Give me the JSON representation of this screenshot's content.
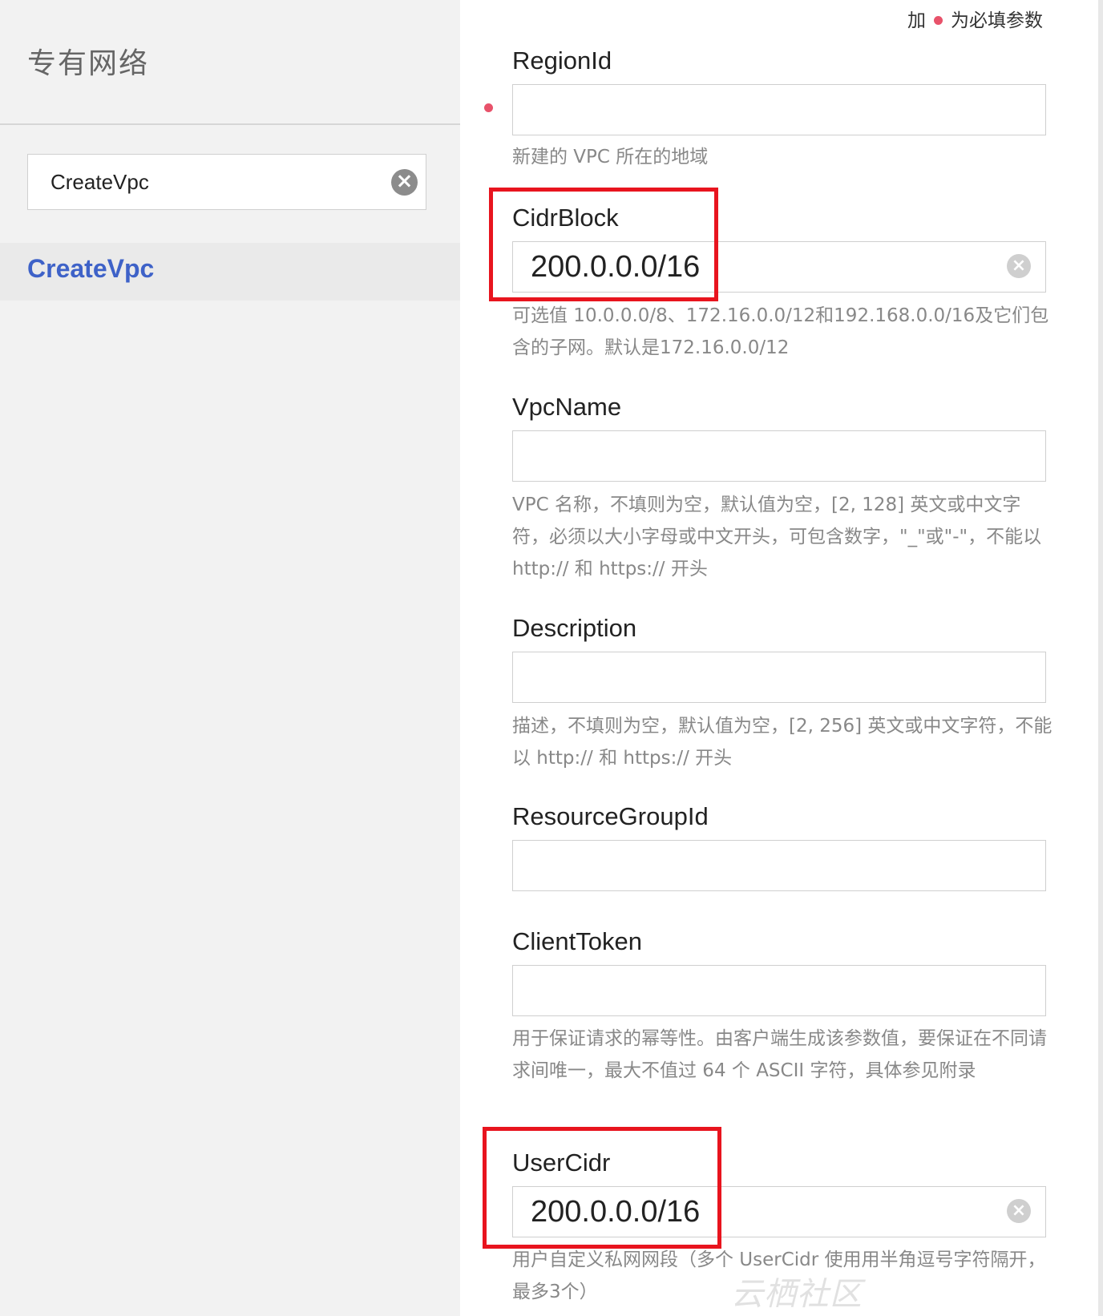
{
  "sidebar": {
    "title": "专有网络",
    "search": {
      "value": "CreateVpc",
      "clear_icon": "×"
    },
    "api_item": "CreateVpc"
  },
  "main": {
    "required_note_prefix": "加",
    "required_note_suffix": "为必填参数",
    "fields": [
      {
        "label": "RegionId",
        "value": "",
        "required": true,
        "help": "新建的 VPC 所在的地域"
      },
      {
        "label": "CidrBlock",
        "value": "200.0.0.0/16",
        "required": false,
        "help": "可选值 10.0.0.0/8、172.16.0.0/12和192.168.0.0/16及它们包含的子网。默认是172.16.0.0/12"
      },
      {
        "label": "VpcName",
        "value": "",
        "required": false,
        "help": "VPC 名称，不填则为空，默认值为空，[2, 128] 英文或中文字符，必须以大小字母或中文开头，可包含数字，\"_\"或\"-\"，不能以 http:// 和 https:// 开头"
      },
      {
        "label": "Description",
        "value": "",
        "required": false,
        "help": "描述，不填则为空，默认值为空，[2, 256] 英文或中文字符，不能以 http:// 和 https:// 开头"
      },
      {
        "label": "ResourceGroupId",
        "value": "",
        "required": false,
        "help": ""
      },
      {
        "label": "ClientToken",
        "value": "",
        "required": false,
        "help": "用于保证请求的幂等性。由客户端生成该参数值，要保证在不同请求间唯一，最大不值过 64 个 ASCII 字符，具体参见附录"
      },
      {
        "label": "UserCidr",
        "value": "200.0.0.0/16",
        "required": false,
        "help": "用户自定义私网网段（多个 UserCidr 使用用半角逗号字符隔开，最多3个）"
      }
    ],
    "clear_icon": "×"
  },
  "watermark": "云栖社区 yq.aliyun.com",
  "colors": {
    "accent": "#3e62c8",
    "required": "#e8526a",
    "highlight": "#e8141e"
  }
}
